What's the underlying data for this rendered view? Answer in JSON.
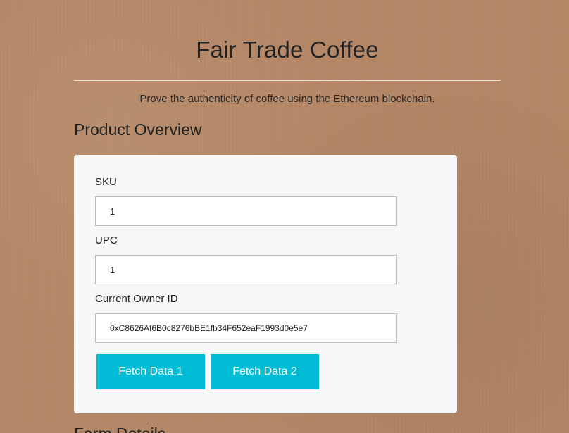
{
  "header": {
    "title": "Fair Trade Coffee",
    "subtitle": "Prove the authenticity of coffee using the Ethereum blockchain."
  },
  "product_overview": {
    "heading": "Product Overview",
    "sku": {
      "label": "SKU",
      "value": "1"
    },
    "upc": {
      "label": "UPC",
      "value": "1"
    },
    "owner": {
      "label": "Current Owner ID",
      "value": "0xC8626Af6B0c8276bBE1fb34F652eaF1993d0e5e7"
    },
    "buttons": {
      "fetch1": "Fetch Data 1",
      "fetch2": "Fetch Data 2"
    }
  },
  "next_section": {
    "heading": "Farm Details"
  },
  "colors": {
    "background": "#b48766",
    "card": "#f7f7f7",
    "button": "#00bcd4",
    "button_text": "#f4fbfc"
  }
}
